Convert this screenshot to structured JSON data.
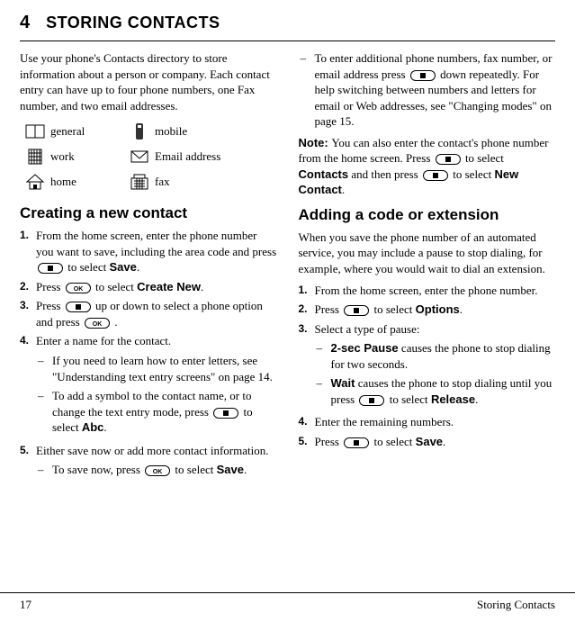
{
  "chapter": {
    "number": "4",
    "title": "STORING CONTACTS"
  },
  "intro": "Use your phone's Contacts directory to store information about a person or company. Each contact entry can have up to four phone numbers, one Fax number, and two email addresses.",
  "iconTable": {
    "r1c1": "general",
    "r1c2": "mobile",
    "r2c1": "work",
    "r2c2": "Email address",
    "r3c1": "home",
    "r3c2": "fax"
  },
  "section1": {
    "heading": "Creating a new contact",
    "step1a": "From the home screen, enter the phone number you want to save, including the area code and press ",
    "step1b": " to select ",
    "step1c": "Save",
    "step1d": ".",
    "step2a": "Press ",
    "step2b": " to select ",
    "step2c": "Create New",
    "step2d": ".",
    "step3a": "Press ",
    "step3b": " up or down to select a phone option and press ",
    "step3c": " .",
    "step4": "Enter a name for the contact.",
    "bullets4": {
      "b1": "If you need to learn how to enter letters, see \"Understanding text entry screens\" on page 14.",
      "b2a": "To add a symbol to the contact name, or to change the text entry mode, press ",
      "b2b": " to select ",
      "b2c": "Abc",
      "b2d": "."
    },
    "step5": "Either save now or add more contact information.",
    "bullets5": {
      "b1a": "To save now, press ",
      "b1b": " to select ",
      "b1c": "Save",
      "b1d": "."
    }
  },
  "rightCol": {
    "contBullet": {
      "a": "To enter additional phone numbers, fax number, or email address press ",
      "b": " down repeatedly. For help switching between numbers and letters for email or Web addresses, see \"Changing modes\" on page 15."
    },
    "noteLabel": "Note:  ",
    "note_a": "You can also enter the contact's phone number from the home screen. Press ",
    "note_b": " to select ",
    "note_c": "Contacts",
    "note_d": " and then press ",
    "note_e": " to select ",
    "note_f": "New Contact",
    "note_g": ".",
    "section2": {
      "heading": "Adding a code or extension",
      "intro": "When you save the phone number of an automated service, you may include a pause to stop dialing, for example, where you would wait to dial an extension.",
      "step1": "From the home screen, enter the phone number.",
      "step2a": "Press ",
      "step2b": " to select ",
      "step2c": "Options",
      "step2d": ".",
      "step3": "Select a type of pause:",
      "bullets3": {
        "b1a": "2-sec Pause",
        "b1b": " causes the phone to stop dialing for two seconds.",
        "b2a": "Wait",
        "b2b": " causes the phone to stop dialing until you press ",
        "b2c": " to select ",
        "b2d": "Release",
        "b2e": "."
      },
      "step4": "Enter the remaining numbers.",
      "step5a": "Press ",
      "step5b": " to select ",
      "step5c": "Save",
      "step5d": "."
    }
  },
  "footer": {
    "pageNum": "17",
    "section": "Storing Contacts"
  }
}
